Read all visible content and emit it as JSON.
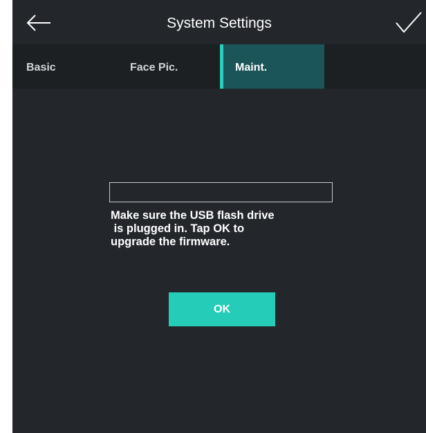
{
  "header": {
    "title": "System Settings",
    "back_icon": "arrow-left-icon",
    "confirm_icon": "checkmark-icon"
  },
  "tabs": [
    {
      "label": "Basic",
      "active": false
    },
    {
      "label": "Face Pic.",
      "active": false
    },
    {
      "label": "Maint.",
      "active": true
    }
  ],
  "upgrade": {
    "progress_fraction": 0,
    "message": "Make sure the USB flash drive\n is plugged in. Tap OK to\nupgrade the firmware.",
    "ok_label": "OK"
  },
  "colors": {
    "background": "#23272c",
    "tabbar": "#1c2023",
    "active_tab": "#1b5459",
    "accent": "#27d1bd"
  }
}
